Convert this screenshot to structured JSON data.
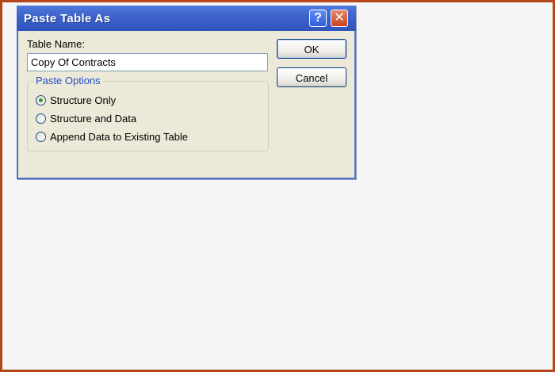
{
  "dialog": {
    "title": "Paste Table As",
    "help_label": "?",
    "close_label": "✕",
    "table_name_label": "Table Name:",
    "table_name_value": "Copy Of Contracts",
    "paste_options_label": "Paste Options",
    "options": [
      {
        "label": "Structure Only",
        "selected": true
      },
      {
        "label": "Structure and Data",
        "selected": false
      },
      {
        "label": "Append Data to Existing Table",
        "selected": false
      }
    ],
    "ok_label": "OK",
    "cancel_label": "Cancel"
  },
  "icons": {
    "help": "question-mark-icon",
    "close": "close-icon"
  },
  "colors": {
    "titlebar": "#3d62cb",
    "dialog_bg": "#ece9d8",
    "group_legend": "#1f4fc8",
    "radio_dot": "#3b9a2c",
    "outer_frame": "#b5461a"
  }
}
